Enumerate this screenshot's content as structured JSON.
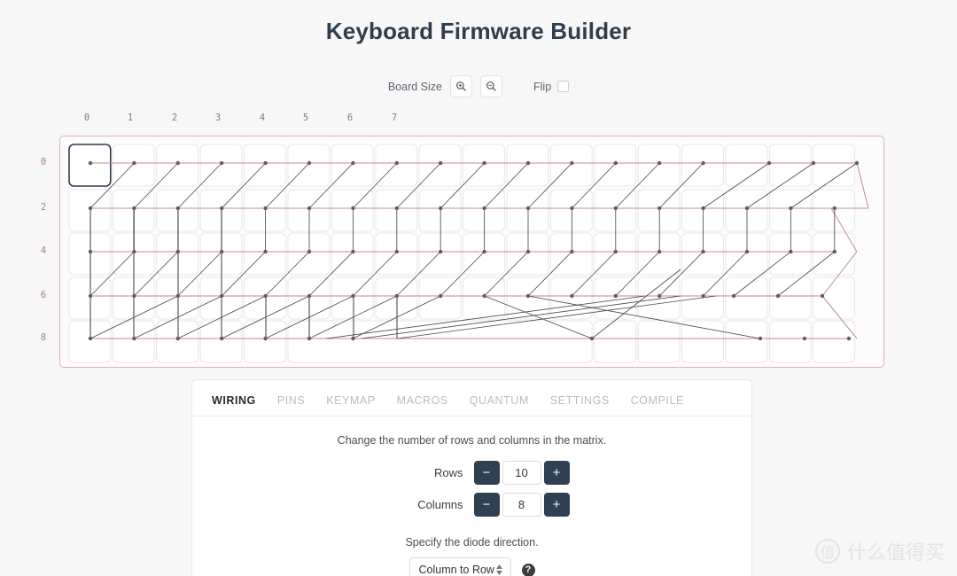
{
  "header": {
    "title": "Keyboard Firmware Builder"
  },
  "toolbar": {
    "board_size_label": "Board Size",
    "zoom_in_icon": "magnifier-plus-icon",
    "zoom_out_icon": "magnifier-minus-icon",
    "flip_label": "Flip",
    "flip_checked": false
  },
  "matrix": {
    "column_labels": [
      "0",
      "1",
      "2",
      "3",
      "4",
      "5",
      "6",
      "7"
    ],
    "row_labels": [
      "0",
      "2",
      "4",
      "6",
      "8"
    ],
    "row_wire_color": "#c08e8e",
    "column_wire_color": "#4a4a55",
    "panel_border_color": "#d9b3b3",
    "selected_key_color": "#2e3a4a",
    "key_border_color": "#e8e8e8"
  },
  "tabs": [
    {
      "label": "WIRING",
      "active": true
    },
    {
      "label": "PINS",
      "active": false
    },
    {
      "label": "KEYMAP",
      "active": false
    },
    {
      "label": "MACROS",
      "active": false
    },
    {
      "label": "QUANTUM",
      "active": false
    },
    {
      "label": "SETTINGS",
      "active": false
    },
    {
      "label": "COMPILE",
      "active": false
    }
  ],
  "wiring": {
    "matrix_hint": "Change the number of rows and columns in the matrix.",
    "rows_label": "Rows",
    "rows_value": "10",
    "columns_label": "Columns",
    "columns_value": "8",
    "decrement_label": "−",
    "increment_label": "+",
    "diode_hint": "Specify the diode direction.",
    "diode_value": "Column to Row",
    "help_label": "?"
  },
  "watermark": {
    "mark": "值",
    "text": "什么值得买"
  }
}
